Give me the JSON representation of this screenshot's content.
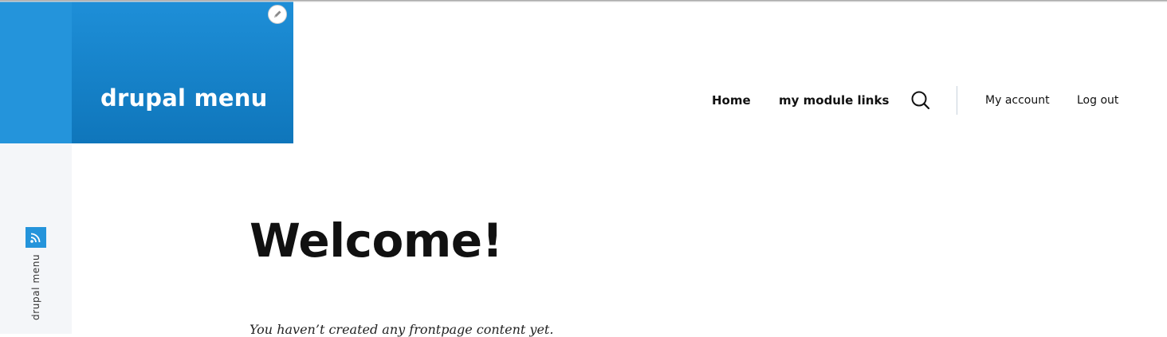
{
  "site": {
    "name": "drupal menu"
  },
  "nav": {
    "main": [
      {
        "label": "Home"
      },
      {
        "label": "my module links"
      }
    ],
    "search_icon": "search-icon",
    "account": [
      {
        "label": "My account"
      },
      {
        "label": "Log out"
      }
    ]
  },
  "sidebar": {
    "shortcut_icon": "feed-icon",
    "label": "drupal menu"
  },
  "main": {
    "title": "Welcome!",
    "empty_message": "You haven’t created any frontpage content yet."
  },
  "colors": {
    "brand_blue": "#2494db",
    "brand_blue_dark": "#0f76bb"
  }
}
